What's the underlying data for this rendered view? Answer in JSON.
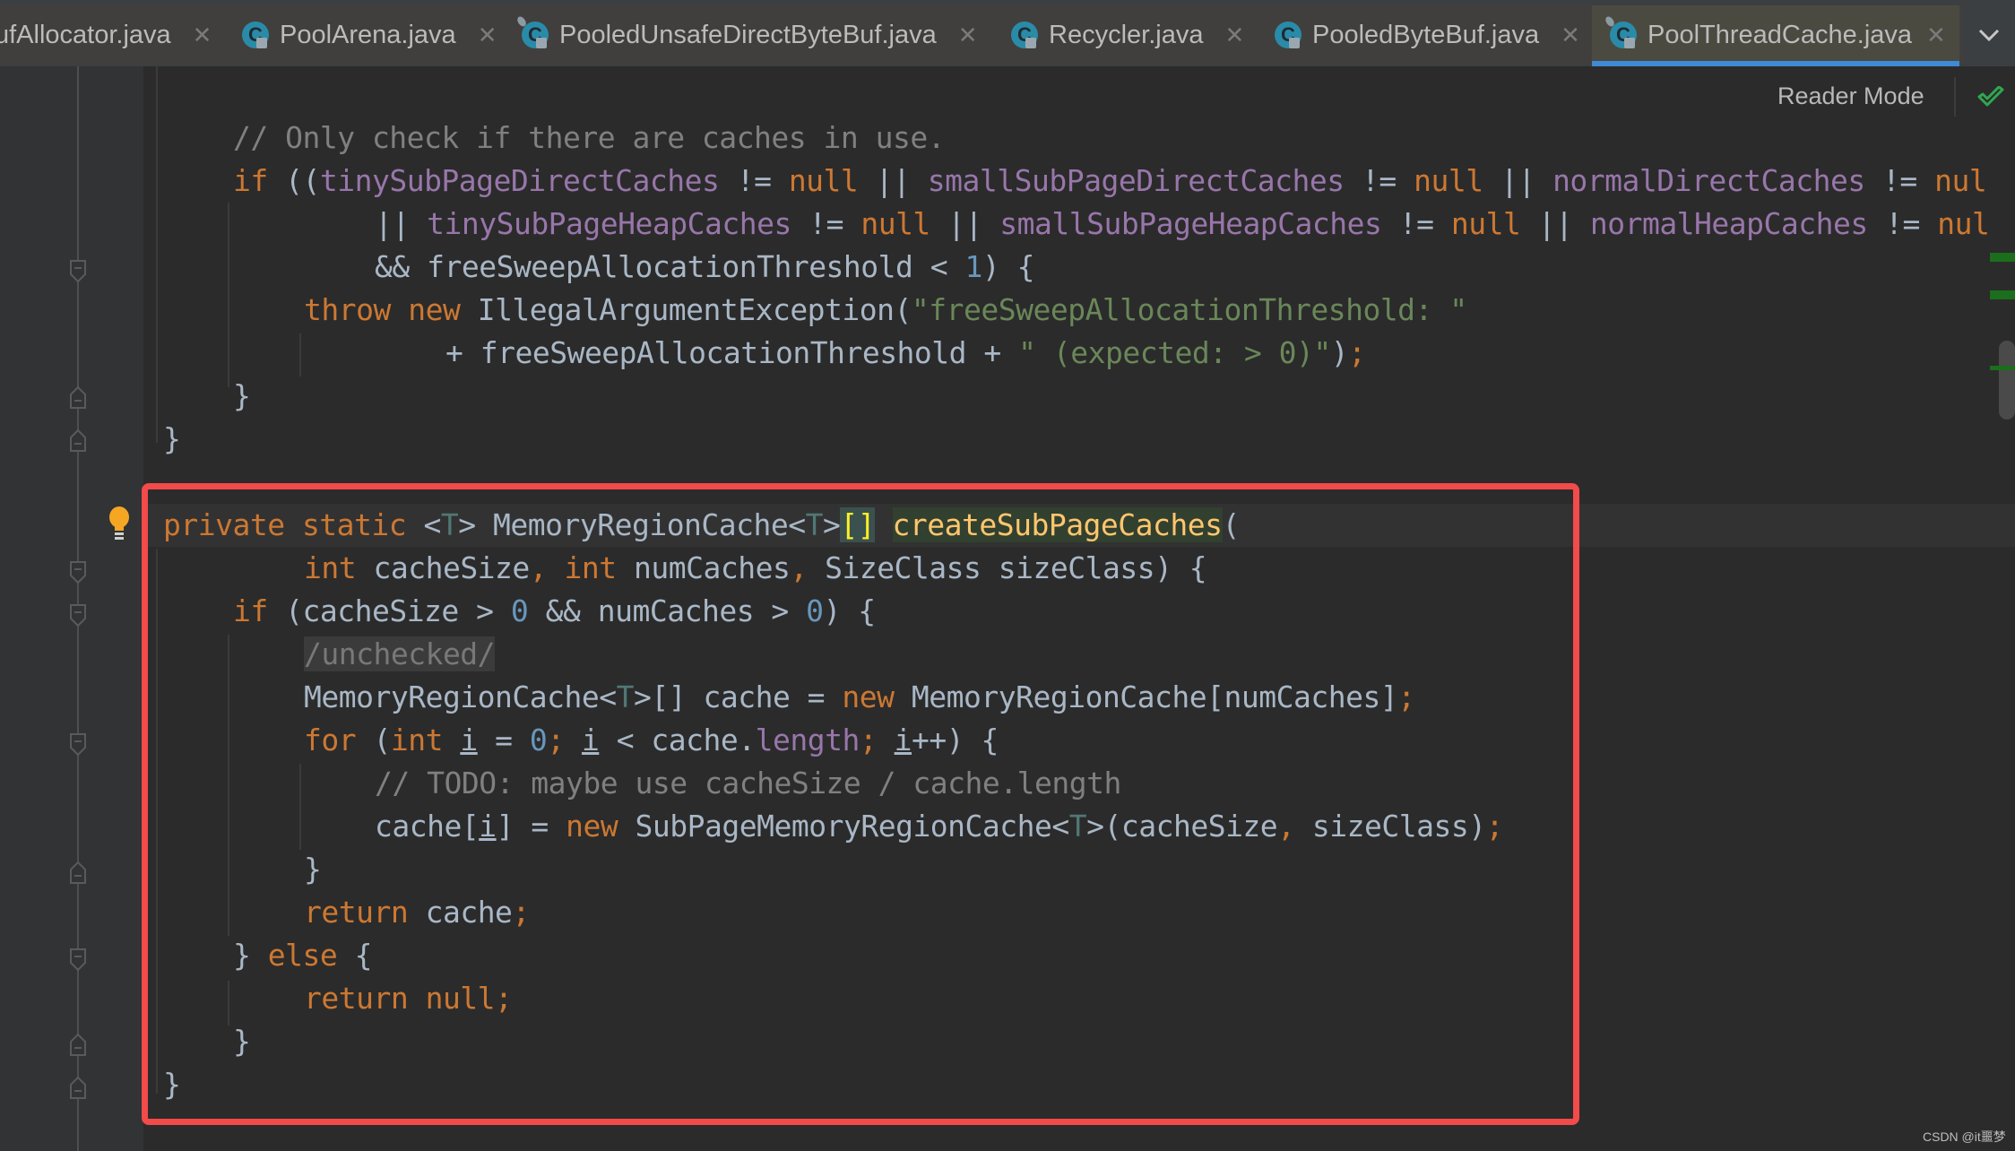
{
  "tabs": [
    {
      "label": "ufAllocator.java",
      "active": false
    },
    {
      "label": "PoolArena.java",
      "active": false
    },
    {
      "label": "PooledUnsafeDirectByteBuf.java",
      "active": false
    },
    {
      "label": "Recycler.java",
      "active": false
    },
    {
      "label": "PooledByteBuf.java",
      "active": false
    },
    {
      "label": "PoolThreadCache.java",
      "active": true
    }
  ],
  "tab_close_glyph": "✕",
  "tab_more_glyph": "⌄",
  "toolbar": {
    "reader_mode_label": "Reader Mode",
    "inspection_status": "no-problems-check"
  },
  "colors": {
    "keyword": "#cc7832",
    "field": "#9876aa",
    "comment": "#808080",
    "string": "#6a8759",
    "number": "#6897bb",
    "type_param": "#507874",
    "method_decl": "#ffc66d",
    "highlight_box": "#f34a4a",
    "active_tab_underline": "#3d8ad6"
  },
  "code": {
    "l01": [
      "// Only check if there are caches in use."
    ],
    "l02": [
      "if",
      " ((",
      "tinySubPageDirectCaches",
      " != ",
      "null",
      " || ",
      "smallSubPageDirectCaches",
      " != ",
      "null",
      " || ",
      "normalDirectCaches",
      " != ",
      "nul"
    ],
    "l03": [
      "|| ",
      "tinySubPageHeapCaches",
      " != ",
      "null",
      " || ",
      "smallSubPageHeapCaches",
      " != ",
      "null",
      " || ",
      "normalHeapCaches",
      " != ",
      "nul"
    ],
    "l04": [
      "&& freeSweepAllocationThreshold < ",
      "1",
      ") {"
    ],
    "l05": [
      "throw",
      " ",
      "new",
      " IllegalArgumentException(",
      "\"freeSweepAllocationThreshold: \""
    ],
    "l06": [
      "+ freeSweepAllocationThreshold + ",
      "\" (expected: > 0)\"",
      ")",
      ";"
    ],
    "l07": [
      "}"
    ],
    "l08": [
      "}"
    ],
    "l09": [
      "private static",
      " <",
      "T",
      "> MemoryRegionCache<",
      "T",
      ">",
      "[]",
      " ",
      "createSubPageCaches",
      "("
    ],
    "l10": [
      "int",
      " cacheSize",
      ",",
      " ",
      "int",
      " numCaches",
      ",",
      " SizeClass sizeClass) {"
    ],
    "l11": [
      "if",
      " (cacheSize > ",
      "0",
      " && numCaches > ",
      "0",
      ") {"
    ],
    "l12": [
      "/unchecked/"
    ],
    "l13": [
      "MemoryRegionCache<",
      "T",
      ">[] cache = ",
      "new",
      " MemoryRegionCache[numCaches]",
      ";"
    ],
    "l14": [
      "for",
      " (",
      "int",
      " ",
      "i",
      " = ",
      "0",
      ";",
      " ",
      "i",
      " < cache.",
      "length",
      ";",
      " ",
      "i",
      "++) {"
    ],
    "l15": [
      "// TODO: maybe use cacheSize / cache.length"
    ],
    "l16": [
      "cache[",
      "i",
      "] = ",
      "new",
      " SubPageMemoryRegionCache<",
      "T",
      ">(cacheSize",
      ",",
      " sizeClass)",
      ";"
    ],
    "l17": [
      "}"
    ],
    "l18": [
      "return",
      " cache",
      ";"
    ],
    "l19": [
      "} ",
      "else",
      " {"
    ],
    "l20": [
      "return null",
      ";"
    ],
    "l21": [
      "}"
    ],
    "l22": [
      "}"
    ]
  },
  "watermark": "CSDN @it噩梦"
}
